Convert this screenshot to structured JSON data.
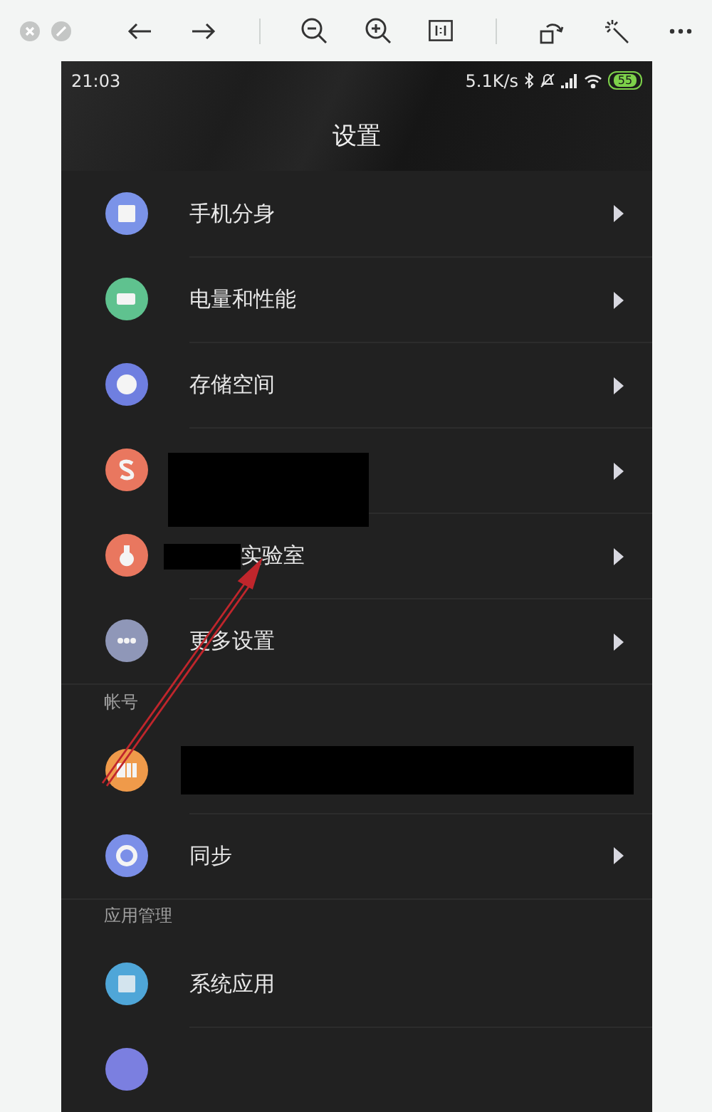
{
  "status_bar": {
    "time": "21:03",
    "speed": "5.1K/s",
    "battery": "55"
  },
  "title": "设置",
  "sections": [
    {
      "items": [
        {
          "label": "手机分身",
          "color": "#7b93e8",
          "redacted": false,
          "chevron": true
        },
        {
          "label": "电量和性能",
          "color": "#5fc28f",
          "redacted": false,
          "chevron": true
        },
        {
          "label": "存储空间",
          "color": "#6f7fe0",
          "redacted": false,
          "chevron": true
        },
        {
          "color": "#e9775f",
          "redacted": true,
          "chevron": true
        },
        {
          "label": "实验室",
          "color": "#e9775f",
          "redacted": true,
          "chevron": true
        },
        {
          "label": "更多设置",
          "color": "#8f97b8",
          "redacted": false,
          "chevron": true
        }
      ]
    },
    {
      "header": "帐号",
      "items": [
        {
          "color": "#ef9a4a",
          "redacted": true,
          "chevron": false
        },
        {
          "label": "同步",
          "color": "#7b8fe8",
          "redacted": false,
          "chevron": true
        }
      ]
    },
    {
      "header": "应用管理",
      "items": [
        {
          "label": "系统应用",
          "color": "#4fa6d8",
          "redacted": false,
          "chevron": false
        },
        {
          "color": "#7b7fe0",
          "redacted": false,
          "chevron": false
        }
      ]
    }
  ]
}
